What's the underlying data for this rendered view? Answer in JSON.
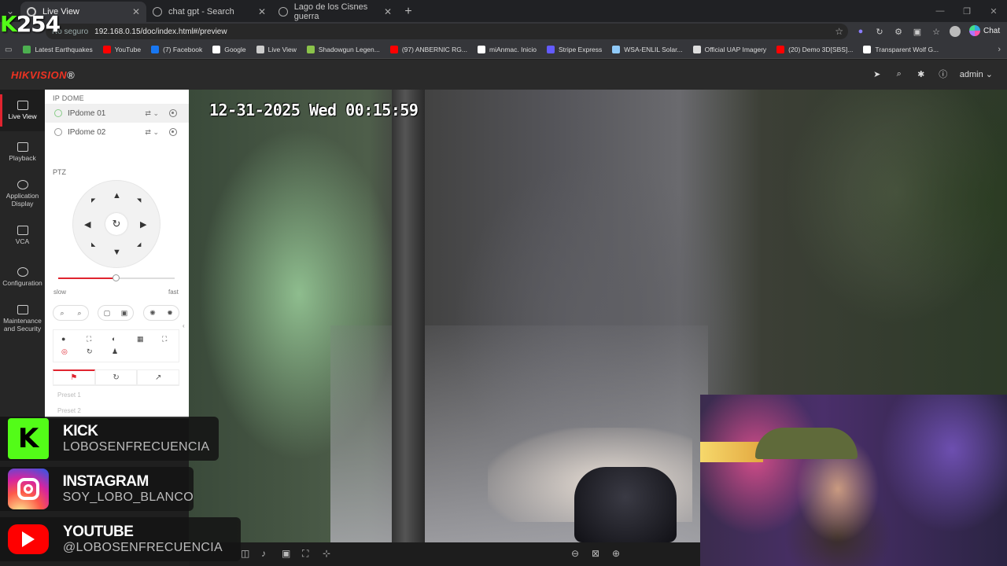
{
  "browser": {
    "tabs": [
      {
        "title": "Live View",
        "active": true
      },
      {
        "title": "chat gpt - Search",
        "active": false
      },
      {
        "title": "Lago de los Cisnes guerra",
        "active": false
      }
    ],
    "address": {
      "security": "No seguro",
      "url": "192.168.0.15/doc/index.html#/preview"
    },
    "chat_label": "Chat",
    "bookmarks": [
      {
        "label": "Latest Earthquakes",
        "color": "#4caf50"
      },
      {
        "label": "YouTube",
        "color": "#ff0000"
      },
      {
        "label": "(7) Facebook",
        "color": "#1877f2"
      },
      {
        "label": "Google",
        "color": "#ffffff"
      },
      {
        "label": "Live View",
        "color": "#cccccc"
      },
      {
        "label": "Shadowgun Legen...",
        "color": "#8bc34a"
      },
      {
        "label": "(97) ANBERNIC RG...",
        "color": "#ff0000"
      },
      {
        "label": "miAnmac. Inicio",
        "color": "#ffffff"
      },
      {
        "label": "Stripe Express",
        "color": "#635bff"
      },
      {
        "label": "WSA-ENLIL Solar...",
        "color": "#90caf9"
      },
      {
        "label": "Official UAP Imagery",
        "color": "#dddddd"
      },
      {
        "label": "(20) Demo 3D[SBS]...",
        "color": "#ff0000"
      },
      {
        "label": "Transparent Wolf G...",
        "color": "#ffffff"
      }
    ]
  },
  "overlay_counter": {
    "k": "K",
    "value": "254"
  },
  "app": {
    "brand": "HIKVISION",
    "brand_mark": "®",
    "user": "admin",
    "nav": [
      {
        "label": "Live View",
        "active": true
      },
      {
        "label": "Playback",
        "active": false
      },
      {
        "label": "Application Display",
        "active": false
      },
      {
        "label": "VCA",
        "active": false
      },
      {
        "label": "Configuration",
        "active": false
      },
      {
        "label": "Maintenance and Security",
        "active": false
      }
    ],
    "panel": {
      "group_title": "IP DOME",
      "cameras": [
        {
          "name": "IPdome 01",
          "selected": true
        },
        {
          "name": "IPdome 02",
          "selected": false
        }
      ],
      "ptz_label": "PTZ",
      "speed_fraction": 0.49,
      "speed_min_label": "slow",
      "speed_max_label": "fast",
      "presets": [
        "Preset 1",
        "Preset 2"
      ]
    },
    "osd_timestamp": "12-31-2025 Wed 00:15:59"
  },
  "social": [
    {
      "network": "KICK",
      "handle": "LOBOSENFRECUENCIA"
    },
    {
      "network": "INSTAGRAM",
      "handle": "SOY_LOBO_BLANCO"
    },
    {
      "network": "YOUTUBE",
      "handle": "@LOBOSENFRECUENCIA"
    }
  ]
}
